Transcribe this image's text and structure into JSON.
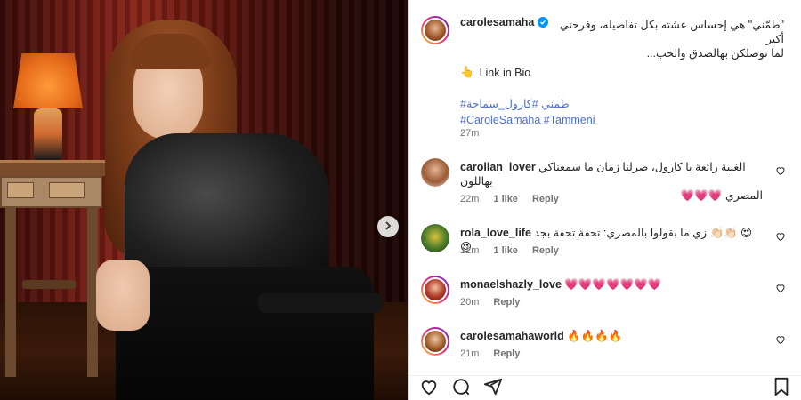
{
  "post": {
    "author": "carolesamaha",
    "caption_line1": "\"طمّني\" هي إحساس عشته بكل تفاصيله، وفرحتي أكبر",
    "caption_line2": "لما توصلكن بهالصدق والحب...",
    "link_emoji": "👆",
    "link_text": "Link in Bio",
    "hashtags_line1": "#طمني #كارول_سماحة",
    "hashtags_line2": "#CaroleSamaha #Tammeni",
    "time": "27m"
  },
  "comments": [
    {
      "username": "carolian_lover",
      "text_line1": "الغنية رائعة يا كارول، صرلنا زمان ما سمعناكي بهاللون",
      "text_line2": "المصري 💗💗💗",
      "time": "22m",
      "likes": "1 like",
      "reply": "Reply"
    },
    {
      "username": "rola_love_life",
      "text_line1": "زي ما بقولوا بالمصري: تحفة تحفة بجد 👏🏻👏🏻 😍😍",
      "time": "12m",
      "likes": "1 like",
      "reply": "Reply"
    },
    {
      "username": "monaelshazly_love",
      "text_line1": "💗💗💗💗💗💗💗",
      "time": "20m",
      "reply": "Reply"
    },
    {
      "username": "carolesamahaworld",
      "text_line1": "🔥🔥🔥🔥",
      "time": "21m",
      "reply": "Reply"
    }
  ],
  "icons": {
    "like": "heart-icon",
    "comment": "comment-icon",
    "share": "send-icon",
    "save": "bookmark-icon",
    "next": "chevron-right-icon",
    "verified": "verified-badge-icon"
  },
  "colors": {
    "verified": "#0095f6",
    "hashtag": "#4a6fd0",
    "muted": "#737373"
  }
}
